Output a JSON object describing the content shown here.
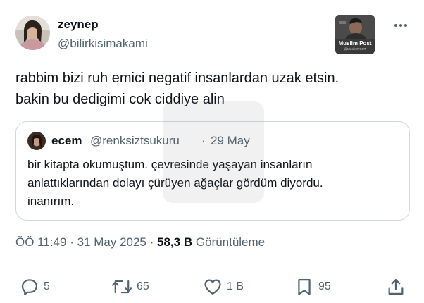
{
  "author": {
    "name": "zeynep",
    "handle": "@bilirkisimakami"
  },
  "badge": {
    "title": "Muslim Post",
    "subtitle": "@MuslimPOST"
  },
  "tweet": {
    "lines": [
      "rabbim bizi ruh emici negatif insanlardan uzak etsin.",
      "bakin bu dedigimi cok ciddiye alin"
    ]
  },
  "quote": {
    "name": "ecem",
    "handle": "@renksiztsukuru",
    "separator": "·",
    "date": "29 May",
    "lines": [
      "bir kitapta okumuştum. çevresinde yaşayan insanların",
      "anlattıklarından dolayı çürüyen ağaçlar gördüm diyordu.",
      "inanırım."
    ]
  },
  "meta": {
    "time": "ÖÖ 11:49",
    "separator1": "·",
    "date": "31 May 2025",
    "separator2": "·",
    "views": "58,3 B",
    "views_label": "Görüntüleme"
  },
  "actions": {
    "replies": "5",
    "reposts": "65",
    "likes": "1 B",
    "bookmarks": "95"
  },
  "colors": {
    "text": "#0f1419",
    "secondary": "#536471",
    "border": "#cfd9de"
  }
}
